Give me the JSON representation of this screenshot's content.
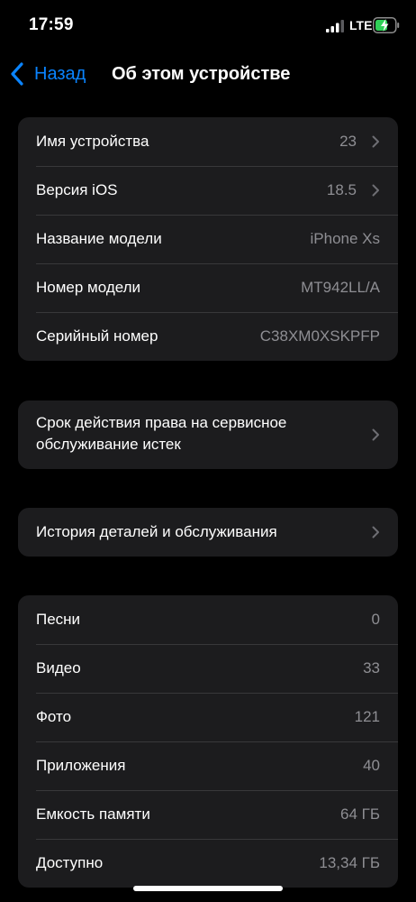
{
  "status_bar": {
    "time": "17:59",
    "network": "LTE",
    "battery_color": "#30d158"
  },
  "nav": {
    "back_label": "Назад",
    "title": "Об этом устройстве",
    "accent_color": "#0a84ff"
  },
  "device_info": [
    {
      "label": "Имя устройства",
      "value": "23",
      "chevron": true
    },
    {
      "label": "Версия iOS",
      "value": "18.5",
      "chevron": true
    },
    {
      "label": "Название модели",
      "value": "iPhone Xs",
      "chevron": false
    },
    {
      "label": "Номер модели",
      "value": "MT942LL/A",
      "chevron": false
    },
    {
      "label": "Серийный номер",
      "value": "C38XM0XSKPFP",
      "chevron": false
    }
  ],
  "service": {
    "label": "Срок действия права на сервисное обслуживание истек"
  },
  "parts_history": {
    "label": "История деталей и обслуживания"
  },
  "stats": [
    {
      "label": "Песни",
      "value": "0"
    },
    {
      "label": "Видео",
      "value": "33"
    },
    {
      "label": "Фото",
      "value": "121"
    },
    {
      "label": "Приложения",
      "value": "40"
    },
    {
      "label": "Емкость памяти",
      "value": "64 ГБ"
    },
    {
      "label": "Доступно",
      "value": "13,34 ГБ"
    }
  ]
}
